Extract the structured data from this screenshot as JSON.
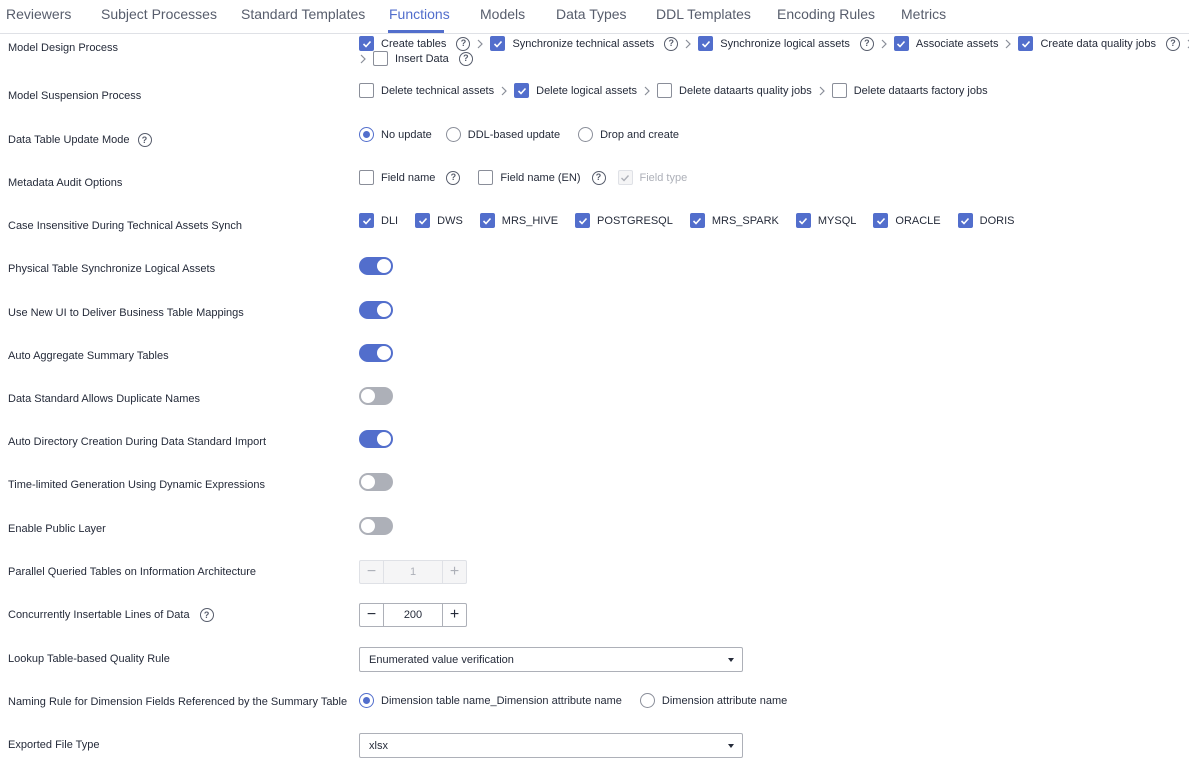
{
  "tabs": [
    {
      "label": "Reviewers"
    },
    {
      "label": "Subject Processes"
    },
    {
      "label": "Standard Templates"
    },
    {
      "label": "Functions",
      "active": true
    },
    {
      "label": "Models"
    },
    {
      "label": "Data Types"
    },
    {
      "label": "DDL Templates"
    },
    {
      "label": "Encoding Rules"
    },
    {
      "label": "Metrics"
    }
  ],
  "rows": {
    "model_design": {
      "label": "Model Design Process",
      "steps": [
        {
          "label": "Create tables",
          "checked": true
        },
        {
          "label": "Synchronize technical assets",
          "checked": true
        },
        {
          "label": "Synchronize logical assets",
          "checked": true
        },
        {
          "label": "Associate assets",
          "checked": true
        },
        {
          "label": "Create data quality jobs",
          "checked": true
        },
        {
          "label": "Insert Data",
          "checked": false
        }
      ]
    },
    "model_suspension": {
      "label": "Model Suspension Process",
      "steps": [
        {
          "label": "Delete technical assets",
          "checked": false
        },
        {
          "label": "Delete logical assets",
          "checked": true
        },
        {
          "label": "Delete dataarts quality jobs",
          "checked": false
        },
        {
          "label": "Delete dataarts factory jobs",
          "checked": false
        }
      ]
    },
    "table_update": {
      "label": "Data Table Update Mode",
      "options": [
        {
          "label": "No update",
          "selected": true
        },
        {
          "label": "DDL-based update",
          "selected": false
        },
        {
          "label": "Drop and create",
          "selected": false
        }
      ]
    },
    "metadata_audit": {
      "label": "Metadata Audit Options",
      "options": [
        {
          "label": "Field name",
          "checked": false
        },
        {
          "label": "Field name (EN)",
          "checked": false
        },
        {
          "label": "Field type",
          "checked": true,
          "disabled": true
        }
      ]
    },
    "case_insensitive": {
      "label": "Case Insensitive During Technical Assets Synch",
      "options": [
        {
          "label": "DLI",
          "checked": true
        },
        {
          "label": "DWS",
          "checked": true
        },
        {
          "label": "MRS_HIVE",
          "checked": true
        },
        {
          "label": "POSTGRESQL",
          "checked": true
        },
        {
          "label": "MRS_SPARK",
          "checked": true
        },
        {
          "label": "MYSQL",
          "checked": true
        },
        {
          "label": "ORACLE",
          "checked": true
        },
        {
          "label": "DORIS",
          "checked": true
        }
      ]
    },
    "toggles": [
      {
        "label": "Physical Table Synchronize Logical Assets",
        "on": true
      },
      {
        "label": "Use New UI to Deliver Business Table Mappings",
        "on": true
      },
      {
        "label": "Auto Aggregate Summary Tables",
        "on": true
      },
      {
        "label": "Data Standard Allows Duplicate Names",
        "on": false
      },
      {
        "label": "Auto Directory Creation During Data Standard Import",
        "on": true
      },
      {
        "label": "Time-limited Generation Using Dynamic Expressions",
        "on": false
      },
      {
        "label": "Enable Public Layer",
        "on": false
      }
    ],
    "parallel_tables": {
      "label": "Parallel Queried Tables on Information Architecture",
      "value": "1",
      "disabled": true
    },
    "concurrent_lines": {
      "label": "Concurrently Insertable Lines of Data",
      "value": "200",
      "disabled": false
    },
    "lookup_rule": {
      "label": "Lookup Table-based Quality Rule",
      "value": "Enumerated value verification"
    },
    "naming_rule": {
      "label": "Naming Rule for Dimension Fields Referenced by the Summary Table",
      "options": [
        {
          "label": "Dimension table name_Dimension attribute name",
          "selected": true
        },
        {
          "label": "Dimension attribute name",
          "selected": false
        }
      ]
    },
    "exported_file": {
      "label": "Exported File Type",
      "value": "xlsx"
    }
  },
  "icons": {
    "help": "?",
    "minus": "−",
    "plus": "+"
  },
  "colors": {
    "accent": "#526ecc",
    "toggle_off": "#adb0b8",
    "text": "#252b3a",
    "muted": "#575d6c"
  }
}
